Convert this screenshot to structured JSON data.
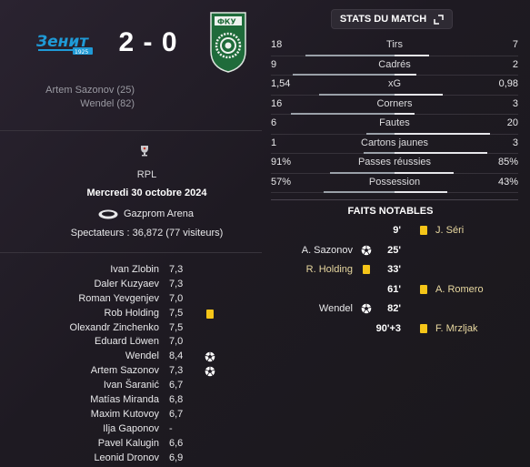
{
  "header": {
    "home_team_logo": "zenit-logo",
    "home_logo_text": "Зенит",
    "home_logo_year": "1925",
    "away_team_logo": "ufa-logo",
    "away_logo_text": "ФКУ",
    "score": "2 - 0",
    "scorers": [
      "Artem Sazonov (25)",
      "Wendel (82)"
    ]
  },
  "match_info": {
    "league_icon": "rpl-trophy-icon",
    "league": "RPL",
    "date": "Mercredi 30 octobre 2024",
    "stadium_icon": "stadium-icon",
    "stadium": "Gazprom Arena",
    "spectators": "Spectateurs : 36,872 (77 visiteurs)"
  },
  "players": [
    {
      "name": "Ivan Zlobin",
      "rating": "7,3",
      "event": ""
    },
    {
      "name": "Daler Kuzyaev",
      "rating": "7,3",
      "event": ""
    },
    {
      "name": "Roman Yevgenjev",
      "rating": "7,0",
      "event": ""
    },
    {
      "name": "Rob Holding",
      "rating": "7,5",
      "event": "yellow-card"
    },
    {
      "name": "Olexandr Zinchenko",
      "rating": "7,5",
      "event": ""
    },
    {
      "name": "Eduard Löwen",
      "rating": "7,0",
      "event": ""
    },
    {
      "name": "Wendel",
      "rating": "8,4",
      "event": "goal"
    },
    {
      "name": "Artem Sazonov",
      "rating": "7,3",
      "event": "goal"
    },
    {
      "name": "Ivan Šaranić",
      "rating": "6,7",
      "event": ""
    },
    {
      "name": "Matías Miranda",
      "rating": "6,8",
      "event": ""
    },
    {
      "name": "Maxim Kutovoy",
      "rating": "6,7",
      "event": ""
    },
    {
      "name": "Ilja Gaponov",
      "rating": "-",
      "event": ""
    },
    {
      "name": "Pavel Kalugin",
      "rating": "6,6",
      "event": ""
    },
    {
      "name": "Leonid Dronov",
      "rating": "6,9",
      "event": ""
    }
  ],
  "stats_button": {
    "label": "STATS DU MATCH",
    "icon": "expand-icon"
  },
  "stats": [
    {
      "home": "18",
      "label": "Tirs",
      "away": "7",
      "home_share": 0.72
    },
    {
      "home": "9",
      "label": "Cadrés",
      "away": "2",
      "home_share": 0.82
    },
    {
      "home": "1,54",
      "label": "xG",
      "away": "0,98",
      "home_share": 0.61
    },
    {
      "home": "16",
      "label": "Corners",
      "away": "3",
      "home_share": 0.84
    },
    {
      "home": "6",
      "label": "Fautes",
      "away": "20",
      "home_share": 0.23
    },
    {
      "home": "1",
      "label": "Cartons jaunes",
      "away": "3",
      "home_share": 0.25
    },
    {
      "home": "91%",
      "label": "Passes réussies",
      "away": "85%",
      "home_share": 0.52
    },
    {
      "home": "57%",
      "label": "Possession",
      "away": "43%",
      "home_share": 0.57
    }
  ],
  "faits": {
    "title": "FAITS NOTABLES",
    "events": [
      {
        "minute": "9'",
        "side": "away",
        "player": "J. Séri",
        "type": "yellow-card"
      },
      {
        "minute": "25'",
        "side": "home",
        "player": "A. Sazonov",
        "type": "goal"
      },
      {
        "minute": "33'",
        "side": "home",
        "player": "R. Holding",
        "type": "yellow-card"
      },
      {
        "minute": "61'",
        "side": "away",
        "player": "A. Romero",
        "type": "yellow-card"
      },
      {
        "minute": "82'",
        "side": "home",
        "player": "Wendel",
        "type": "goal"
      },
      {
        "minute": "90'+3",
        "side": "away",
        "player": "F. Mrzljak",
        "type": "yellow-card"
      }
    ]
  },
  "colors": {
    "yellow_card": "#f5c518",
    "highlight_text": "#e8d8a0",
    "zenit_blue": "#1f9ad6",
    "ufa_green": "#1f6b3a"
  }
}
